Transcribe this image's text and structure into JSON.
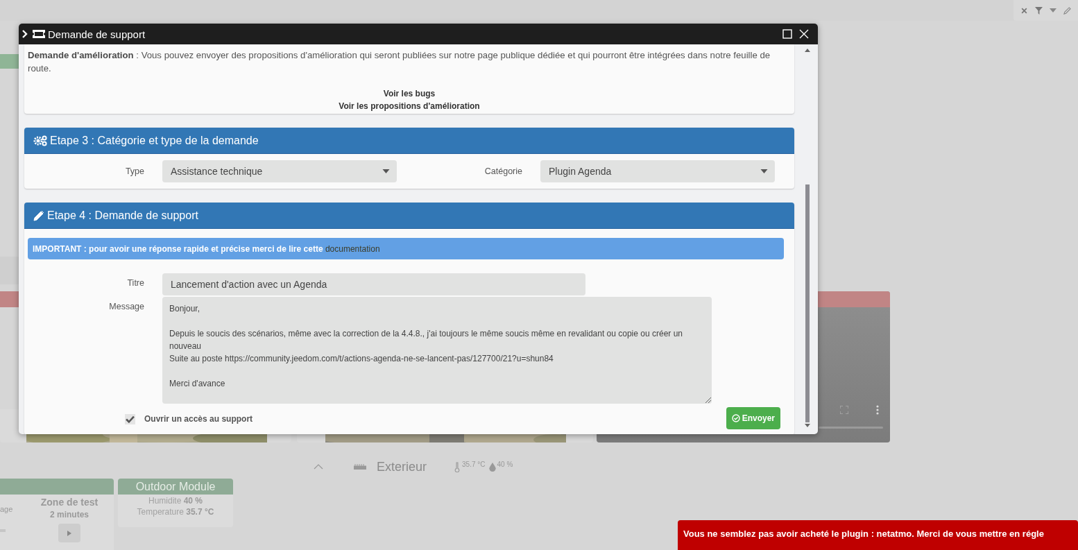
{
  "dashboard": {
    "section": {
      "title": "Exterieur",
      "temperature": "35.7 °C",
      "humidity": "40 %"
    },
    "widgets": [
      {
        "kind": "scenario",
        "cut_text": "age",
        "title": "Zone de test",
        "subtitle": "2 minutes"
      },
      {
        "kind": "module",
        "title": "Outdoor Module",
        "lines": [
          {
            "label": "Humidite",
            "value": "40 %"
          },
          {
            "label": "Temperature",
            "value": "35.7 °C"
          }
        ]
      }
    ]
  },
  "dialog": {
    "title": "Demande de support",
    "intro": "**Demande d'amélioration** : Vous pouvez envoyer des propositions d'amélioration qui seront publiées sur notre page publique dédiée et qui pourront être intégrées dans notre feuille de route.",
    "links": [
      "Voir les bugs",
      "Voir les propositions d'amélioration"
    ],
    "step3": {
      "title": "Etape 3 : Catégorie et type de la demande",
      "fields": [
        {
          "label": "Type",
          "value": "Assistance technique"
        },
        {
          "label": "Catégorie",
          "value": "Plugin Agenda"
        }
      ]
    },
    "step4": {
      "title": "Etape 4 : Demande de support",
      "notice": {
        "text": "IMPORTANT : pour avoir une réponse rapide et précise merci de lire cette",
        "link": "documentation"
      },
      "title_field": {
        "label": "Titre",
        "value": "Lancement d'action avec un Agenda"
      },
      "message": {
        "label": "Message",
        "value": "Bonjour,\n\nDepuis le soucis des scénarios, même avec la correction de la 4.4.8., j'ai toujours le même soucis même en revalidant ou copie ou créer un\nnouveau\nSuite au poste https://community.jeedom.com/t/actions-agenda-ne-se-lancent-pas/127700/21?u=shun84\n\nMerci d'avance"
      },
      "support_access": {
        "label": "Ouvrir un accès au support",
        "checked": true
      },
      "submit": "Envoyer"
    }
  },
  "toast": "Vous ne semblez pas avoir acheté le plugin : netatmo. Merci de vous mettre en régle"
}
